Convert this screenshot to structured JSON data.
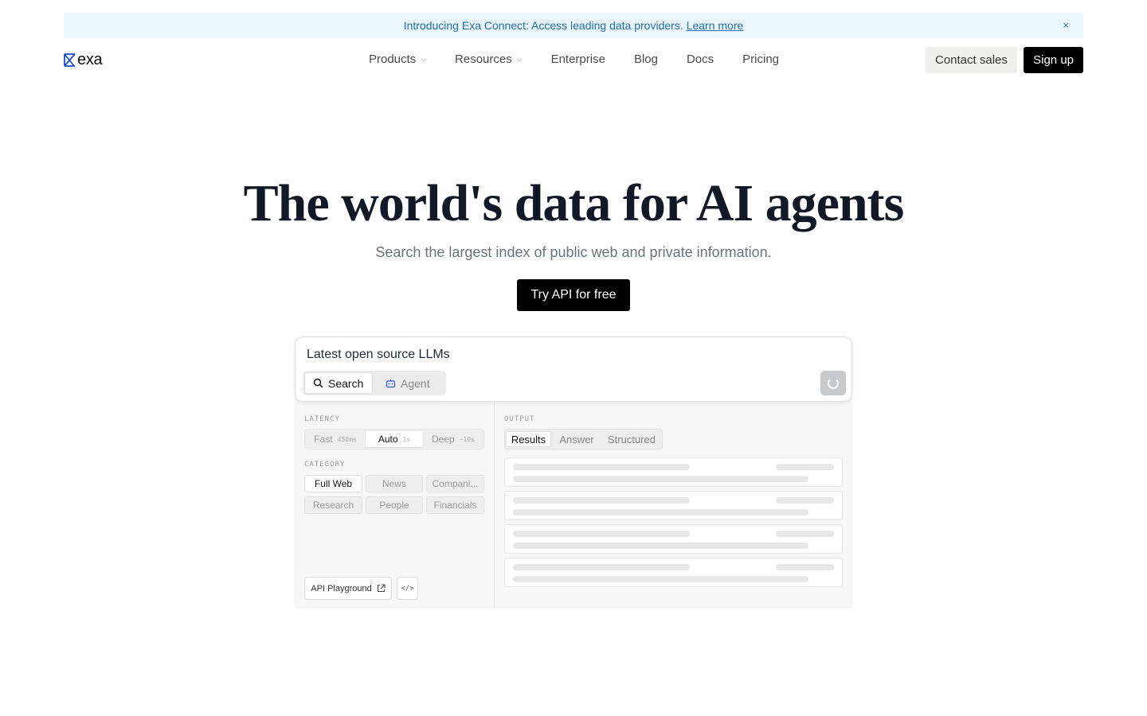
{
  "banner": {
    "text": "Introducing Exa Connect: Access leading data providers.",
    "link": "Learn more",
    "close": "×"
  },
  "nav": {
    "logo": "exa",
    "items": [
      {
        "label": "Products",
        "dropdown": true
      },
      {
        "label": "Resources",
        "dropdown": true
      },
      {
        "label": "Enterprise"
      },
      {
        "label": "Blog"
      },
      {
        "label": "Docs"
      },
      {
        "label": "Pricing"
      }
    ],
    "contact": "Contact sales",
    "signup": "Sign up"
  },
  "hero": {
    "title": "The world's data for AI agents",
    "subtitle": "Search the largest index of public web and private information.",
    "cta": "Try API for free"
  },
  "demo": {
    "query": "Latest open source LLMs",
    "modes": {
      "search": "Search",
      "agent": "Agent"
    },
    "latency": {
      "label": "LATENCY",
      "options": [
        {
          "name": "Fast",
          "sub": "450ms"
        },
        {
          "name": "Auto",
          "sub": "1s"
        },
        {
          "name": "Deep",
          "sub": "~10s"
        }
      ],
      "selected": "Auto"
    },
    "category": {
      "label": "CATEGORY",
      "options": [
        "Full Web",
        "News",
        "Compani...",
        "Research",
        "People",
        "Financials"
      ],
      "selected": "Full Web"
    },
    "playground": "API Playground",
    "code_icon": "</>",
    "output": {
      "label": "OUTPUT",
      "tabs": [
        "Results",
        "Answer",
        "Structured"
      ],
      "selected": "Results"
    }
  },
  "icons": {
    "logo_mark": "exa-logo-icon",
    "close": "close-icon",
    "search": "search-icon",
    "agent": "agent-icon",
    "external": "external-link-icon",
    "spinner": "spinner-icon"
  },
  "colors": {
    "banner_bg": "#eaf6fc",
    "banner_text": "#1f6fb4",
    "primary": "#000000",
    "logo_blue": "#1f4fd1"
  }
}
